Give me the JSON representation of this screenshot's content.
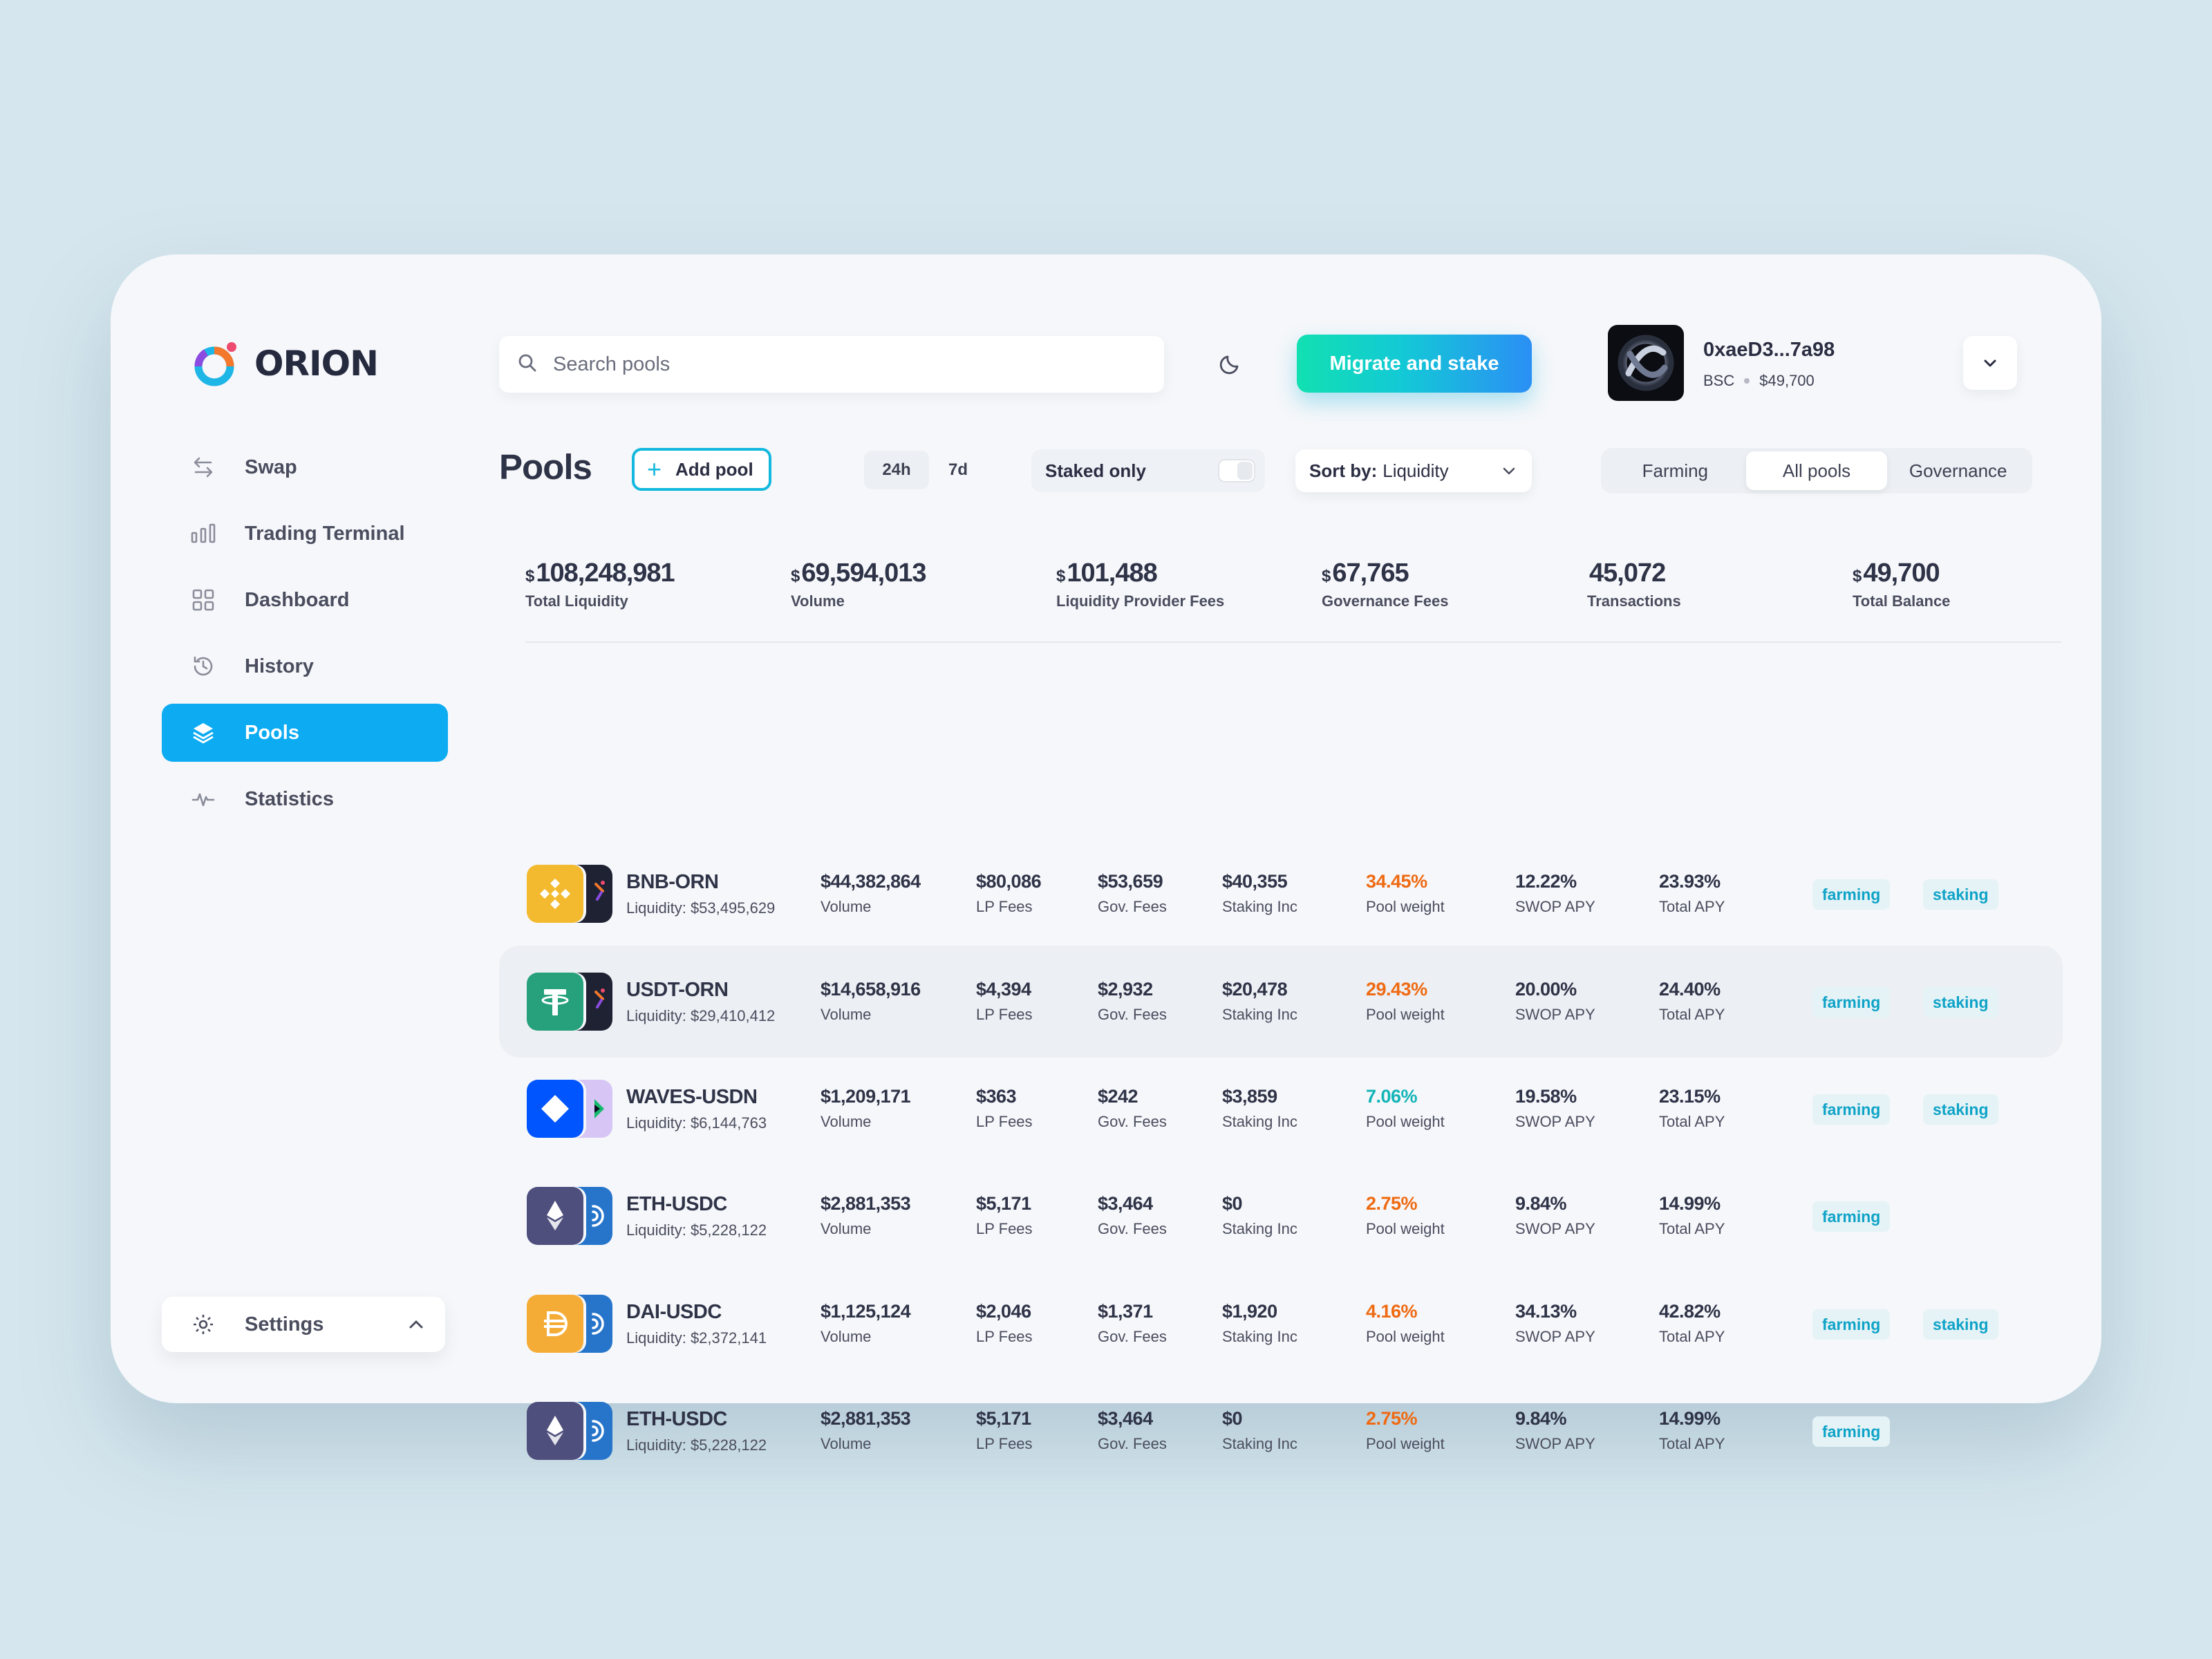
{
  "app": {
    "name": "ORION"
  },
  "colors": {
    "accent": "#0cabf2",
    "cta_from": "#12e0b1",
    "cta_to": "#2b8ff5",
    "pool_weight_orange": "#ef6a12",
    "pool_weight_teal": "#14b4b8",
    "tag": "#0fa3c7"
  },
  "sidebar": {
    "items": [
      {
        "label": "Swap",
        "icon": "swap-arrows-icon"
      },
      {
        "label": "Trading Terminal",
        "icon": "bar-chart-icon"
      },
      {
        "label": "Dashboard",
        "icon": "grid-icon"
      },
      {
        "label": "History",
        "icon": "history-clock-icon"
      },
      {
        "label": "Pools",
        "icon": "layers-icon",
        "active": true
      },
      {
        "label": "Statistics",
        "icon": "pulse-icon"
      }
    ],
    "settings_label": "Settings"
  },
  "header": {
    "search_placeholder": "Search pools",
    "cta_label": "Migrate and stake",
    "wallet": {
      "address": "0xaeD3...7a98",
      "network": "BSC",
      "balance": "$49,700"
    }
  },
  "toolbar": {
    "title": "Pools",
    "add_pool_label": "Add pool",
    "periods": [
      "24h",
      "7d"
    ],
    "active_period": "24h",
    "staked_only_label": "Staked only",
    "staked_only_on": false,
    "sort_prefix": "Sort by:",
    "sort_value": "Liquidity",
    "segments": [
      "Farming",
      "All pools",
      "Governance"
    ],
    "active_segment": "All pools"
  },
  "stats": [
    {
      "currency": "$",
      "value": "108,248,981",
      "label": "Total Liquidity"
    },
    {
      "currency": "$",
      "value": "69,594,013",
      "label": "Volume"
    },
    {
      "currency": "$",
      "value": "101,488",
      "label": "Liquidity Provider Fees"
    },
    {
      "currency": "$",
      "value": "67,765",
      "label": "Governance Fees"
    },
    {
      "currency": "",
      "value": "45,072",
      "label": "Transactions"
    },
    {
      "currency": "$",
      "value": "49,700",
      "label": "Total Balance"
    }
  ],
  "columns": {
    "volume": "Volume",
    "lp_fees": "LP Fees",
    "gov_fees": "Gov. Fees",
    "staking": "Staking Inc",
    "pool_weight": "Pool weight",
    "swop_apy": "SWOP APY",
    "total_apy": "Total APY"
  },
  "tags": {
    "farming": "farming",
    "staking": "staking"
  },
  "pools": [
    {
      "name": "BNB-ORN",
      "liquidity": "Liquidity: $53,495,629",
      "volume": "$44,382,864",
      "lp_fees": "$80,086",
      "gov_fees": "$53,659",
      "staking": "$40,355",
      "pool_weight": "34.45%",
      "weight_color": "orange",
      "swop_apy": "12.22%",
      "total_apy": "23.93%",
      "farming": true,
      "staking_tag": true,
      "coin_a": "bnb-icon",
      "coin_b": "orn-icon"
    },
    {
      "name": "USDT-ORN",
      "liquidity": "Liquidity: $29,410,412",
      "volume": "$14,658,916",
      "lp_fees": "$4,394",
      "gov_fees": "$2,932",
      "staking": "$20,478",
      "pool_weight": "29.43%",
      "weight_color": "orange",
      "swop_apy": "20.00%",
      "total_apy": "24.40%",
      "farming": true,
      "staking_tag": true,
      "coin_a": "usdt-icon",
      "coin_b": "orn-icon",
      "highlighted": true
    },
    {
      "name": "WAVES-USDN",
      "liquidity": "Liquidity: $6,144,763",
      "volume": "$1,209,171",
      "lp_fees": "$363",
      "gov_fees": "$242",
      "staking": "$3,859",
      "pool_weight": "7.06%",
      "weight_color": "teal",
      "swop_apy": "19.58%",
      "total_apy": "23.15%",
      "farming": true,
      "staking_tag": true,
      "coin_a": "waves-icon",
      "coin_b": "usdn-icon"
    },
    {
      "name": "ETH-USDC",
      "liquidity": "Liquidity: $5,228,122",
      "volume": "$2,881,353",
      "lp_fees": "$5,171",
      "gov_fees": "$3,464",
      "staking": "$0",
      "pool_weight": "2.75%",
      "weight_color": "orange",
      "swop_apy": "9.84%",
      "total_apy": "14.99%",
      "farming": true,
      "staking_tag": false,
      "coin_a": "eth-icon",
      "coin_b": "usdc-icon"
    },
    {
      "name": "DAI-USDC",
      "liquidity": "Liquidity: $2,372,141",
      "volume": "$1,125,124",
      "lp_fees": "$2,046",
      "gov_fees": "$1,371",
      "staking": "$1,920",
      "pool_weight": "4.16%",
      "weight_color": "orange",
      "swop_apy": "34.13%",
      "total_apy": "42.82%",
      "farming": true,
      "staking_tag": true,
      "coin_a": "dai-icon",
      "coin_b": "usdc-icon"
    },
    {
      "name": "ETH-USDC",
      "liquidity": "Liquidity: $5,228,122",
      "volume": "$2,881,353",
      "lp_fees": "$5,171",
      "gov_fees": "$3,464",
      "staking": "$0",
      "pool_weight": "2.75%",
      "weight_color": "orange",
      "swop_apy": "9.84%",
      "total_apy": "14.99%",
      "farming": true,
      "staking_tag": false,
      "coin_a": "eth-icon",
      "coin_b": "usdc-icon"
    }
  ]
}
